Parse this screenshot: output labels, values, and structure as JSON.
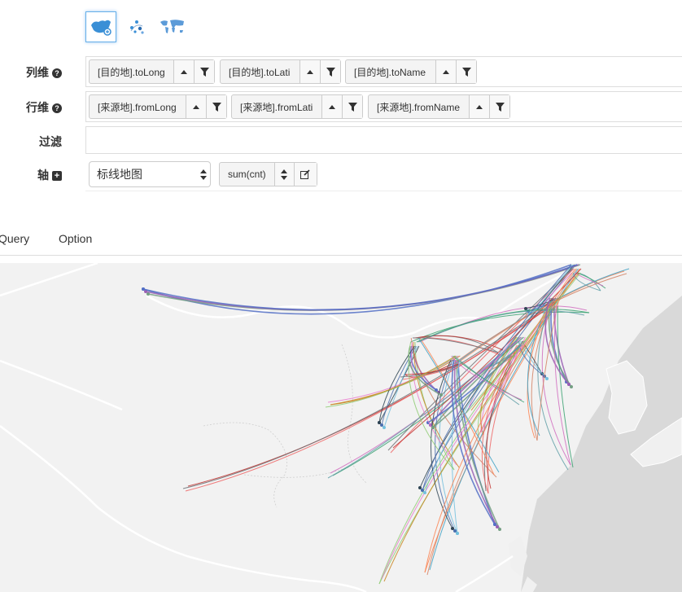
{
  "chart_types": [
    {
      "name": "china-map-chart-icon",
      "active": true
    },
    {
      "name": "scatter-map-chart-icon",
      "active": false
    },
    {
      "name": "world-map-chart-icon",
      "active": false
    }
  ],
  "columns": {
    "label": "列维",
    "items": [
      "[目的地].toLong",
      "[目的地].toLati",
      "[目的地].toName"
    ]
  },
  "rows": {
    "label": "行维",
    "items": [
      "[来源地].fromLong",
      "[来源地].fromLati",
      "[来源地].fromName"
    ]
  },
  "filter": {
    "label": "过滤"
  },
  "axis": {
    "label": "轴",
    "chart_select": "标线地图",
    "measure": "sum(cnt)"
  },
  "tabs": [
    "Query",
    "Option"
  ],
  "colors": {
    "accent_border": "#66afe9",
    "map_land": "#f2f2f2",
    "sea": "#d7d7d7"
  }
}
